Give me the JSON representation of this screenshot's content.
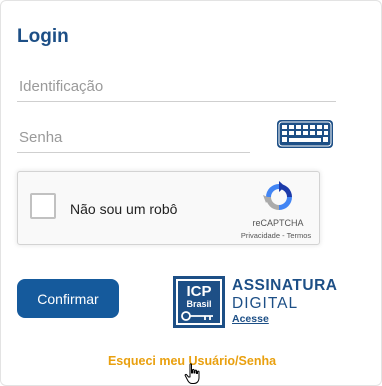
{
  "login": {
    "title": "Login",
    "identification_placeholder": "Identificação",
    "password_placeholder": "Senha"
  },
  "virtual_keyboard": {
    "icon": "keyboard-icon"
  },
  "captcha": {
    "label": "Não sou um robô",
    "brand": "reCAPTCHA",
    "privacy_link": "Privacidade",
    "separator": " - ",
    "terms_link": "Termos",
    "checked": false,
    "icon": "recaptcha-logo-icon"
  },
  "actions": {
    "confirm_label": "Confirmar"
  },
  "digital_signature": {
    "logo_icon": "icp-brasil-logo-icon",
    "line1": "ASSINATURA",
    "line2": "DIGITAL",
    "link": "Acesse"
  },
  "forgot_link": "Esqueci meu Usuário/Senha",
  "colors": {
    "title_blue": "#1d4f86",
    "button_blue": "#155a9c",
    "link_orange": "#e9a00f"
  }
}
